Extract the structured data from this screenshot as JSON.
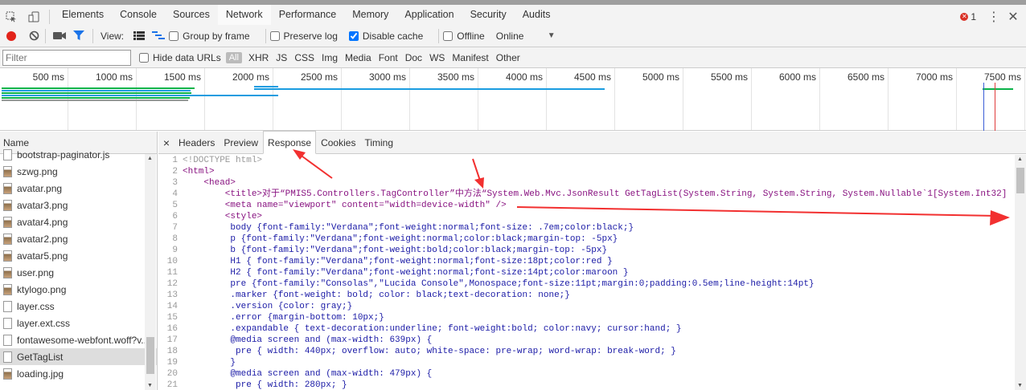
{
  "toolbar": {
    "tabs": [
      "Elements",
      "Console",
      "Sources",
      "Network",
      "Performance",
      "Memory",
      "Application",
      "Security",
      "Audits"
    ],
    "error_count": "1"
  },
  "network_toolbar": {
    "view_label": "View:",
    "group_by_frame": "Group by frame",
    "preserve_log": "Preserve log",
    "disable_cache": "Disable cache",
    "offline": "Offline",
    "throttle": "Online"
  },
  "filter_bar": {
    "placeholder": "Filter",
    "hide_data_urls": "Hide data URLs",
    "types": [
      "All",
      "XHR",
      "JS",
      "CSS",
      "Img",
      "Media",
      "Font",
      "Doc",
      "WS",
      "Manifest",
      "Other"
    ]
  },
  "overview": {
    "ticks": [
      "500 ms",
      "1000 ms",
      "1500 ms",
      "2000 ms",
      "2500 ms",
      "3000 ms",
      "3500 ms",
      "4000 ms",
      "4500 ms",
      "5000 ms",
      "5500 ms",
      "6000 ms",
      "6500 ms",
      "7000 ms",
      "7500 ms"
    ]
  },
  "request_list": {
    "header": "Name",
    "items": [
      {
        "name": "bootstrap-paginator.js",
        "type": "js"
      },
      {
        "name": "szwg.png",
        "type": "img"
      },
      {
        "name": "avatar.png",
        "type": "img"
      },
      {
        "name": "avatar3.png",
        "type": "img"
      },
      {
        "name": "avatar4.png",
        "type": "img"
      },
      {
        "name": "avatar2.png",
        "type": "img"
      },
      {
        "name": "avatar5.png",
        "type": "img"
      },
      {
        "name": "user.png",
        "type": "img"
      },
      {
        "name": "ktylogo.png",
        "type": "img"
      },
      {
        "name": "layer.css",
        "type": "css"
      },
      {
        "name": "layer.ext.css",
        "type": "css"
      },
      {
        "name": "fontawesome-webfont.woff?v...",
        "type": "font"
      },
      {
        "name": "GetTagList",
        "type": "doc",
        "selected": true
      },
      {
        "name": "loading.jpg",
        "type": "img"
      }
    ]
  },
  "detail": {
    "close": "×",
    "tabs": [
      "Headers",
      "Preview",
      "Response",
      "Cookies",
      "Timing"
    ],
    "active_tab": "Response",
    "lines": [
      "<!DOCTYPE html>",
      "<html>",
      "    <head>",
      "        <title>对于“PMIS5.Controllers.TagController”中方法“System.Web.Mvc.JsonResult GetTagList(System.String, System.String, System.Nullable`1[System.Int32]",
      "        <meta name=\"viewport\" content=\"width=device-width\" />",
      "        <style>",
      "         body {font-family:\"Verdana\";font-weight:normal;font-size: .7em;color:black;}",
      "         p {font-family:\"Verdana\";font-weight:normal;color:black;margin-top: -5px}",
      "         b {font-family:\"Verdana\";font-weight:bold;color:black;margin-top: -5px}",
      "         H1 { font-family:\"Verdana\";font-weight:normal;font-size:18pt;color:red }",
      "         H2 { font-family:\"Verdana\";font-weight:normal;font-size:14pt;color:maroon }",
      "         pre {font-family:\"Consolas\",\"Lucida Console\",Monospace;font-size:11pt;margin:0;padding:0.5em;line-height:14pt}",
      "         .marker {font-weight: bold; color: black;text-decoration: none;}",
      "         .version {color: gray;}",
      "         .error {margin-bottom: 10px;}",
      "         .expandable { text-decoration:underline; font-weight:bold; color:navy; cursor:hand; }",
      "         @media screen and (max-width: 639px) {",
      "          pre { width: 440px; overflow: auto; white-space: pre-wrap; word-wrap: break-word; }",
      "         }",
      "         @media screen and (max-width: 479px) {",
      "          pre { width: 280px; }"
    ]
  },
  "colors": {
    "accent": "#03a9f4",
    "record": "#e2231a",
    "annotation": "#f23030"
  }
}
